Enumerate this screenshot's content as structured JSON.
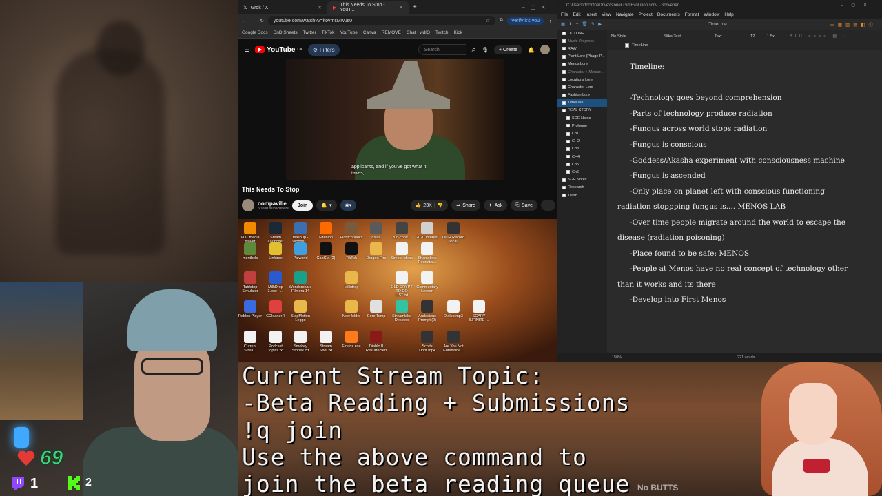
{
  "stream": {
    "hearts_count": "69",
    "twitch_count": "1",
    "kick_count": "2",
    "colors": {
      "heart": "#e53935",
      "hearts_text": "#3fd07a",
      "twitch": "#9146ff",
      "kick": "#53fc18"
    }
  },
  "browser": {
    "tabs": [
      {
        "label": "Grok / X",
        "active": false
      },
      {
        "label": "This Needs To Stop - YouT...",
        "active": true
      }
    ],
    "url": "youtube.com/watch?v=itovmsMwus0",
    "verify_label": "Verify it's you",
    "bookmarks": [
      "Google Docs",
      "DnD Sheets",
      "Twitter",
      "TikTok",
      "YouTube",
      "Canva",
      "REMOVE",
      "Chat | vidIQ",
      "Twitch",
      "Kick"
    ]
  },
  "youtube": {
    "logo": "YouTube",
    "logo_region": "CA",
    "filters_label": "Filters",
    "search_placeholder": "Search",
    "create_label": "Create",
    "subtitle_line1": "applicants, and if you've got what it",
    "subtitle_line2": "takes,",
    "video_title": "This Needs To Stop",
    "channel_name": "oompaville",
    "subscribers": "5.99M subscribers",
    "join_label": "Join",
    "likes": "23K",
    "share_label": "Share",
    "ask_label": "Ask",
    "save_label": "Save"
  },
  "desktop": {
    "icons": [
      {
        "label": "VLC media player",
        "color": "#f08a00",
        "col": 0,
        "row": 0
      },
      {
        "label": "Steam Launcher",
        "color": "#1b2838",
        "col": 1,
        "row": 0
      },
      {
        "label": "Mashup - Wonder...",
        "color": "#3a6fb0",
        "col": 2,
        "row": 0
      },
      {
        "label": "Firebloo",
        "color": "#ff6a00",
        "col": 3,
        "row": 0
      },
      {
        "label": "Eldritchbooks",
        "color": "#7a5a3a",
        "col": 4,
        "row": 0
      },
      {
        "label": "dsida",
        "color": "#5a5a5a",
        "col": 5,
        "row": 0
      },
      {
        "label": "run-conv...",
        "color": "#444",
        "col": 6,
        "row": 0
      },
      {
        "label": "2020 Interest",
        "color": "#d0d0d0",
        "col": 7,
        "row": 0
      },
      {
        "label": "OOR Record (local)",
        "color": "#333",
        "col": 8,
        "row": 0
      },
      {
        "label": "monthels",
        "color": "#5d8a3a",
        "col": 0,
        "row": 1
      },
      {
        "label": "Linktree",
        "color": "#e0c030",
        "col": 1,
        "row": 1
      },
      {
        "label": "Palworld",
        "color": "#3fa0e0",
        "col": 2,
        "row": 1
      },
      {
        "label": "CapCut (2)",
        "color": "#111",
        "col": 3,
        "row": 1
      },
      {
        "label": "TikTok",
        "color": "#111",
        "col": 4,
        "row": 1
      },
      {
        "label": "Dragon Fire",
        "color": "#e8b84a",
        "col": 5,
        "row": 1
      },
      {
        "label": "Simple Ideas",
        "color": "#f2f2f2",
        "col": 6,
        "row": 1
      },
      {
        "label": "Shameless Recruiter...",
        "color": "#f2f2f2",
        "col": 7,
        "row": 1
      },
      {
        "label": "Tabletop Simulator",
        "color": "#c04040",
        "col": 0,
        "row": 2
      },
      {
        "label": "MilkDrop 3.exe - ...",
        "color": "#2a5ad0",
        "col": 1,
        "row": 2
      },
      {
        "label": "Wondershare Filmora 14",
        "color": "#1aa08a",
        "col": 2,
        "row": 2
      },
      {
        "label": "Milkdrop",
        "color": "#e8b84a",
        "col": 4,
        "row": 2
      },
      {
        "label": "OLD CRYPT TO DO LIST.txt",
        "color": "#f2f2f2",
        "col": 6,
        "row": 2
      },
      {
        "label": "Commentary Lesson",
        "color": "#f2f2f2",
        "col": 7,
        "row": 2
      },
      {
        "label": "Roblox Player",
        "color": "#3a6ae0",
        "col": 0,
        "row": 3
      },
      {
        "label": "CCleaner 7",
        "color": "#e04040",
        "col": 1,
        "row": 3
      },
      {
        "label": "StopMotion Leggo",
        "color": "#e8b84a",
        "col": 2,
        "row": 3
      },
      {
        "label": "New folder",
        "color": "#e8b84a",
        "col": 4,
        "row": 3
      },
      {
        "label": "Core Temp",
        "color": "#e0e0e0",
        "col": 5,
        "row": 3
      },
      {
        "label": "Streamlabs Desktop",
        "color": "#31c3a2",
        "col": 6,
        "row": 3
      },
      {
        "label": "Audacious Prompt (2)",
        "color": "#333",
        "col": 7,
        "row": 3
      },
      {
        "label": "Dialup.mp3",
        "color": "#f2f2f2",
        "col": 8,
        "row": 3
      },
      {
        "label": "SCARY INFINITE ...",
        "color": "#f2f2f2",
        "col": 9,
        "row": 3
      },
      {
        "label": "Current Strea...",
        "color": "#f2f2f2",
        "col": 0,
        "row": 4
      },
      {
        "label": "Podcast Topics.txt",
        "color": "#f2f2f2",
        "col": 1,
        "row": 4
      },
      {
        "label": "Smokey Stories.txt",
        "color": "#f2f2f2",
        "col": 2,
        "row": 4
      },
      {
        "label": "Stream Shot.txt",
        "color": "#f2f2f2",
        "col": 3,
        "row": 4
      },
      {
        "label": "Firefox.exe",
        "color": "#ff7a1a",
        "col": 4,
        "row": 4
      },
      {
        "label": "Diablo II Resurrected",
        "color": "#8a1a1a",
        "col": 5,
        "row": 4
      },
      {
        "label": "Scotts Dont.mp4",
        "color": "#333",
        "col": 7,
        "row": 4
      },
      {
        "label": "Are You Not Entertaine...",
        "color": "#333",
        "col": 8,
        "row": 4
      }
    ]
  },
  "scrivener": {
    "title": "C:\\Users\\ttcc\\OneDrive\\Stoner Girl Evolution.scriv - Scrivener",
    "menu": [
      "File",
      "Edit",
      "Insert",
      "View",
      "Navigate",
      "Project",
      "Documents",
      "Format",
      "Window",
      "Help"
    ],
    "toolbar_doc": "TimeLine",
    "binder": [
      {
        "label": "OUTLINE",
        "dim": false,
        "selected": false,
        "indent": 0
      },
      {
        "label": "Music Progress",
        "dim": true,
        "selected": false,
        "indent": 0
      },
      {
        "label": "RAW",
        "dim": false,
        "selected": false,
        "indent": 0
      },
      {
        "label": "Plant Lore (Phage P...",
        "dim": false,
        "selected": false,
        "indent": 0
      },
      {
        "label": "Menos Lore",
        "dim": false,
        "selected": false,
        "indent": 0
      },
      {
        "label": "Character + Mentor...",
        "dim": true,
        "selected": false,
        "indent": 0
      },
      {
        "label": "Locations Lore",
        "dim": false,
        "selected": false,
        "indent": 0
      },
      {
        "label": "Character Lore",
        "dim": false,
        "selected": false,
        "indent": 0
      },
      {
        "label": "Fashion Lore",
        "dim": false,
        "selected": false,
        "indent": 0
      },
      {
        "label": "TimeLine",
        "dim": false,
        "selected": true,
        "indent": 0
      },
      {
        "label": "REAL STORY",
        "dim": false,
        "selected": false,
        "indent": 0
      },
      {
        "label": "SGE Notes",
        "dim": false,
        "selected": false,
        "indent": 1
      },
      {
        "label": "Prologue",
        "dim": false,
        "selected": false,
        "indent": 1
      },
      {
        "label": "Ch1",
        "dim": false,
        "selected": false,
        "indent": 1
      },
      {
        "label": "CH2",
        "dim": false,
        "selected": false,
        "indent": 1
      },
      {
        "label": "Ch3",
        "dim": false,
        "selected": false,
        "indent": 1
      },
      {
        "label": "CH4",
        "dim": false,
        "selected": false,
        "indent": 1
      },
      {
        "label": "Ch5",
        "dim": false,
        "selected": false,
        "indent": 1
      },
      {
        "label": "Ch6",
        "dim": false,
        "selected": false,
        "indent": 1
      },
      {
        "label": "SGE Notes",
        "dim": false,
        "selected": false,
        "indent": 0
      },
      {
        "label": "Research",
        "dim": false,
        "selected": false,
        "indent": 0
      },
      {
        "label": "Trash",
        "dim": false,
        "selected": false,
        "indent": 0
      }
    ],
    "format": {
      "style": "No Style",
      "font": "Sitka Text",
      "variant": "Text",
      "size": "12",
      "spacing": "1.5x"
    },
    "doc_header": "TimeLine",
    "editor_heading": "Timeline:",
    "editor_lines": [
      "-Technology goes beyond comprehension",
      "-Parts of technology produce radiation",
      "-Fungus across world stops radiation",
      "-Fungus is conscious",
      "-Goddess/Akasha experiment with consciousness machine",
      "-Fungus is ascended",
      "-Only place on planet left with conscious functioning",
      "radiation stoppping fungus is.... MENOS LAB",
      "-Over time people migrate around the world to escape the",
      "disease (radiation poisoning)",
      "-Place found to be safe: MENOS",
      "-People at Menos have no real concept of technology other",
      "than it works and its there",
      "-Develop into First Menos"
    ],
    "zoom": "150%",
    "word_count": "221 words"
  },
  "overlay": {
    "lines": [
      "Current Stream Topic:",
      "-Beta Reading + Submissions",
      "!q join",
      "Use the above command to",
      "join the beta reading queue"
    ],
    "chat_fragment": "No BUTTS"
  }
}
